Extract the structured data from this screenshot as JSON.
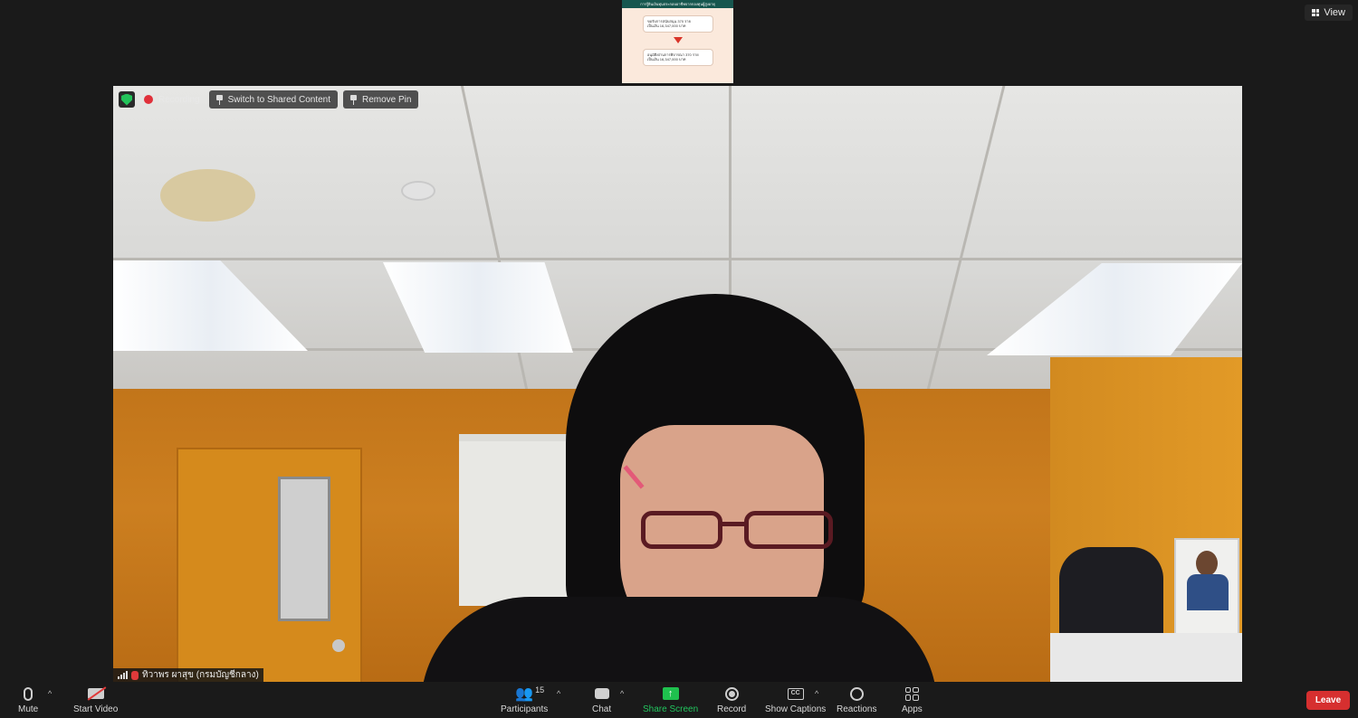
{
  "top": {
    "view_label": "View"
  },
  "shared_content": {
    "header_text": "การรู้ยินเงินทุนประกอบอาชีพจากกองทุนผู้สูงอายุ",
    "card1_line1": "ขอรับการสนับสนุน 370 ราย",
    "card1_line2": "เป็นเงิน 16,347,000 บาท",
    "card2_line1": "อนุมัติ/ผ่านการพิจารณา 370 ราย",
    "card2_line2": "เป็นเงิน 16,347,000 บาท"
  },
  "video_controls": {
    "recording_label": "Recording",
    "switch_label": "Switch to Shared Content",
    "remove_pin_label": "Remove Pin"
  },
  "participant": {
    "name": "ทิวาพร ผาสุข (กรมบัญชีกลาง)"
  },
  "toolbar": {
    "mute": "Mute",
    "start_video": "Start Video",
    "participants": "Participants",
    "participants_count": "15",
    "chat": "Chat",
    "share_screen": "Share Screen",
    "record": "Record",
    "show_captions": "Show Captions",
    "cc_icon_text": "CC",
    "reactions": "Reactions",
    "apps": "Apps",
    "leave": "Leave"
  },
  "colors": {
    "accent_green": "#22c55e",
    "leave_red": "#d62f2f",
    "record_red": "#e0303a"
  }
}
